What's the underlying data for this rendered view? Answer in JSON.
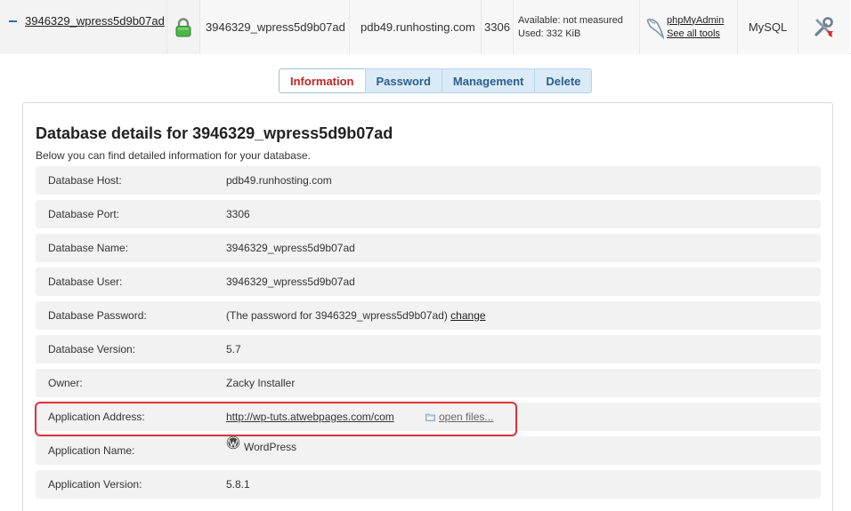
{
  "database_row": {
    "name": "3946329_wpress5d9b07ad",
    "user": "3946329_wpress5d9b07ad",
    "host": "pdb49.runhosting.com",
    "port": "3306",
    "available": "Available: not measured",
    "used": "Used: 332 KiB",
    "pma_label": "phpMyAdmin",
    "all_tools": "See all tools",
    "type": "MySQL"
  },
  "tabs": [
    {
      "label": "Information",
      "active": true
    },
    {
      "label": "Password",
      "active": false
    },
    {
      "label": "Management",
      "active": false
    },
    {
      "label": "Delete",
      "active": false
    }
  ],
  "details": {
    "title": "Database details for 3946329_wpress5d9b07ad",
    "subtitle": "Below you can find detailed information for your database.",
    "rows": {
      "host": {
        "label": "Database Host:",
        "value": "pdb49.runhosting.com"
      },
      "port": {
        "label": "Database Port:",
        "value": "3306"
      },
      "name": {
        "label": "Database Name:",
        "value": "3946329_wpress5d9b07ad"
      },
      "user": {
        "label": "Database User:",
        "value": "3946329_wpress5d9b07ad"
      },
      "password": {
        "label": "Database Password:",
        "value": "(The password for 3946329_wpress5d9b07ad)",
        "link": "change"
      },
      "version": {
        "label": "Database Version:",
        "value": "5.7"
      },
      "owner": {
        "label": "Owner:",
        "value": "Zacky Installer"
      },
      "app_address": {
        "label": "Application Address:",
        "value": "http://wp-tuts.atwebpages.com/com",
        "link": "open files..."
      },
      "app_name": {
        "label": "Application Name:",
        "value": "WordPress"
      },
      "app_version": {
        "label": "Application Version:",
        "value": "5.8.1"
      }
    }
  },
  "colors": {
    "highlight": "#e0303a",
    "tab_active_text": "#c02626",
    "tab_text": "#2b5f8f",
    "tab_bg": "#dbeaf7"
  }
}
